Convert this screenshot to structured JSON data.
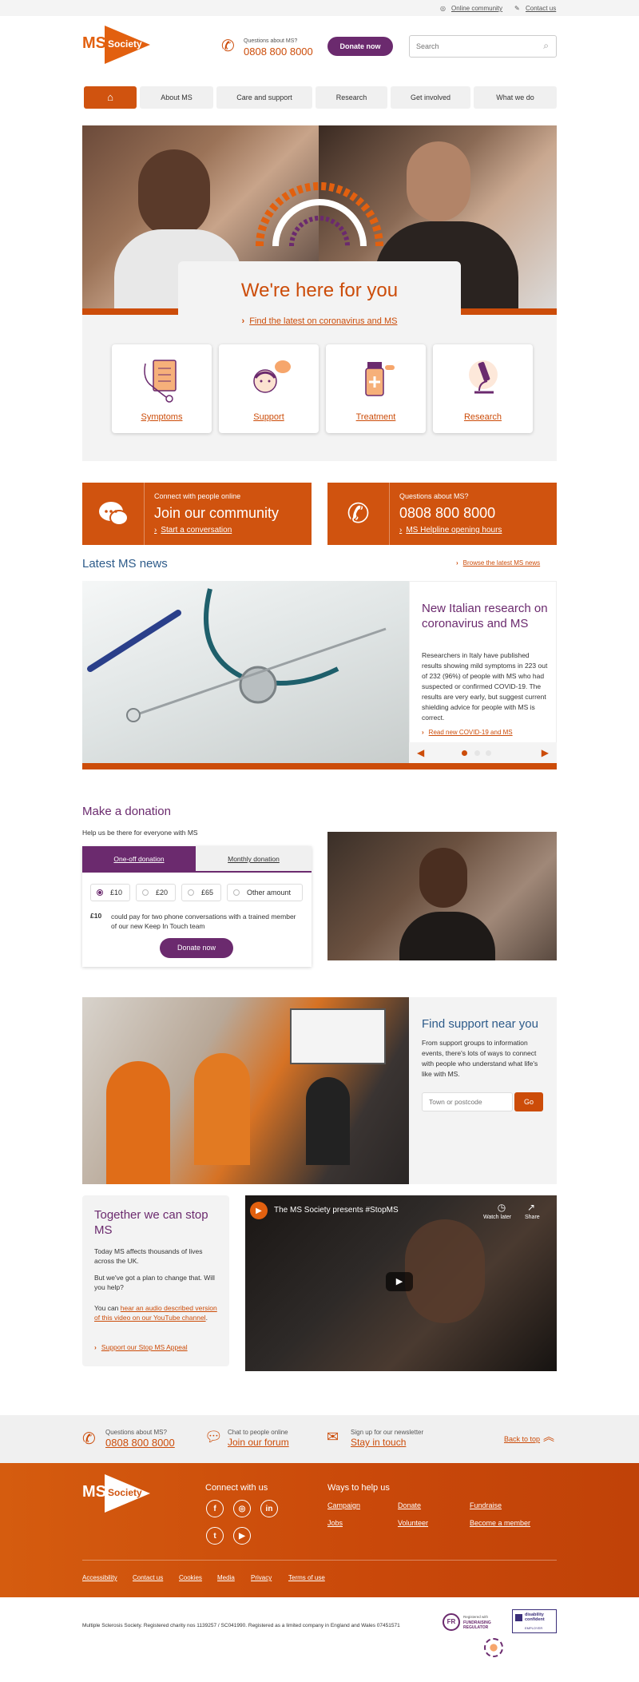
{
  "utility": {
    "community": "Online community",
    "contact": "Contact us"
  },
  "header": {
    "logo_ms": "MS",
    "logo_society": "Society",
    "phone_question": "Questions about MS?",
    "phone_number": "0808 800 8000",
    "donate_label": "Donate now",
    "search_placeholder": "Search"
  },
  "nav": {
    "items": [
      "About MS",
      "Care and support",
      "Research",
      "Get involved",
      "What we do"
    ]
  },
  "hero": {
    "title": "We're here for you",
    "link": "Find the latest on coronavirus and MS",
    "cards": [
      "Symptoms",
      "Support",
      "Treatment",
      "Research"
    ]
  },
  "cta": {
    "community": {
      "small": "Connect with people online",
      "big": "Join our community",
      "link": "Start a conversation"
    },
    "helpline": {
      "small": "Questions about MS?",
      "big": "0808 800 8000",
      "link": "MS Helpline opening hours"
    }
  },
  "news": {
    "heading": "Latest MS news",
    "browse": "Browse the latest MS news",
    "title": "New Italian research on coronavirus and MS",
    "body": "Researchers in Italy have published results showing mild symptoms in 223 out of 232 (96%) of people with MS who had suspected or confirmed COVID-19. The results are very early, but suggest current shielding advice for people with MS is correct.",
    "link": "Read new COVID-19 and MS"
  },
  "donation": {
    "heading": "Make a donation",
    "sub": "Help us be there for everyone with MS",
    "tab_oneoff": "One-off donation",
    "tab_monthly": "Monthly donation",
    "amounts": [
      "£10",
      "£20",
      "£65",
      "Other amount"
    ],
    "selected_amount": "£10",
    "amount_label": "£10",
    "amount_desc": "could pay for two phone conversations with a trained member of our new Keep In Touch team",
    "button": "Donate now"
  },
  "support": {
    "heading": "Find support near you",
    "body": "From support groups to information events, there's lots of ways to connect with people who understand what life's like with MS.",
    "placeholder": "Town or postcode",
    "go": "Go"
  },
  "stopms": {
    "heading": "Together we can stop MS",
    "p1": "Today MS affects thousands of lives across the UK.",
    "p2": "But we've got a plan to change that. Will you help?",
    "p3_pre": "You can ",
    "p3_link": "hear an audio described version of this video on our YouTube channel",
    "p3_post": ".",
    "link": "Support our Stop MS Appeal",
    "video_title": "The MS Society presents #StopMS",
    "watch_later": "Watch later",
    "share": "Share"
  },
  "contact_bar": {
    "q_small": "Questions about MS?",
    "q_big": "0808 800 8000",
    "chat_small": "Chat to people online",
    "chat_big": "Join our forum",
    "news_small": "Sign up for our newsletter",
    "news_big": "Stay in touch",
    "back": "Back to top"
  },
  "footer": {
    "connect": "Connect with us",
    "ways": "Ways to help us",
    "links": [
      "Campaign",
      "Donate",
      "Fundraise",
      "Jobs",
      "Volunteer",
      "Become a member"
    ],
    "bottom_links": [
      "Accessibility",
      "Contact us",
      "Cookies",
      "Media",
      "Privacy",
      "Terms of use"
    ],
    "legal": "Multiple Sclerosis Society. Registered charity nos 1139257 / SC041990. Registered as a limited company in England and Wales 07451571",
    "fr_small": "Registered with",
    "fr_big": "FUNDRAISING REGULATOR",
    "dc_big": "disability confident",
    "dc_small": "EMPLOYER"
  },
  "colors": {
    "orange": "#cc4c09",
    "purple": "#6b2a6e",
    "blue": "#2d5b8a"
  }
}
